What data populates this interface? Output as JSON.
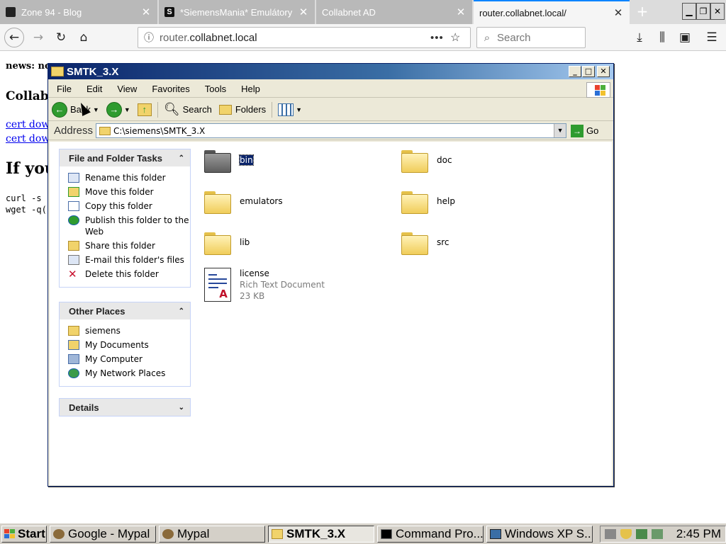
{
  "browser": {
    "tabs": [
      {
        "label": "Zone 94 - Blog",
        "active": false
      },
      {
        "label": "*SiemensMania* Emulátory",
        "active": false
      },
      {
        "label": "Collabnet AD",
        "active": false
      },
      {
        "label": "router.collabnet.local/",
        "active": true
      }
    ],
    "new_tab_label": "+",
    "url_domain": "router.",
    "url_host": "collabnet.local",
    "search_placeholder": "Search"
  },
  "webpage": {
    "news": "news: no",
    "heading": "Collabl",
    "links": [
      "cert down",
      "cert down"
    ],
    "big_heading": "If you",
    "code_lines": [
      "curl -s",
      "wget -q("
    ]
  },
  "explorer": {
    "title": "SMTK_3.X",
    "menu": [
      "File",
      "Edit",
      "View",
      "Favorites",
      "Tools",
      "Help"
    ],
    "toolbar": {
      "back_label": "Back",
      "search_label": "Search",
      "folders_label": "Folders"
    },
    "address": {
      "label": "Address",
      "value": "C:\\siemens\\SMTK_3.X",
      "go_label": "Go"
    },
    "tasks_pane": {
      "title": "File and Folder Tasks",
      "items": [
        "Rename this folder",
        "Move this folder",
        "Copy this folder",
        "Publish this folder to the Web",
        "Share this folder",
        "E-mail this folder's files",
        "Delete this folder"
      ]
    },
    "places_pane": {
      "title": "Other Places",
      "items": [
        "siemens",
        "My Documents",
        "My Computer",
        "My Network Places"
      ]
    },
    "details_pane": {
      "title": "Details"
    },
    "files": [
      {
        "name": "bin",
        "kind": "folder",
        "selected": true
      },
      {
        "name": "doc",
        "kind": "folder"
      },
      {
        "name": "emulators",
        "kind": "folder"
      },
      {
        "name": "help",
        "kind": "folder"
      },
      {
        "name": "lib",
        "kind": "folder"
      },
      {
        "name": "src",
        "kind": "folder"
      },
      {
        "name": "license",
        "kind": "document",
        "type": "Rich Text Document",
        "size": "23 KB"
      }
    ]
  },
  "taskbar": {
    "start_label": "Start",
    "tasks": [
      {
        "label": "Google - Mypal",
        "active": false
      },
      {
        "label": "Mypal",
        "active": false
      },
      {
        "label": "SMTK_3.X",
        "active": true
      },
      {
        "label": "Command Pro...",
        "active": false
      },
      {
        "label": "Windows XP S...",
        "active": false
      }
    ],
    "clock": "2:45 PM"
  },
  "colors": {
    "xp_title_blue": "#0a246a",
    "selection_blue": "#0a246a",
    "firefox_accent": "#0a84ff",
    "folder_yellow": "#f0cd5a"
  }
}
